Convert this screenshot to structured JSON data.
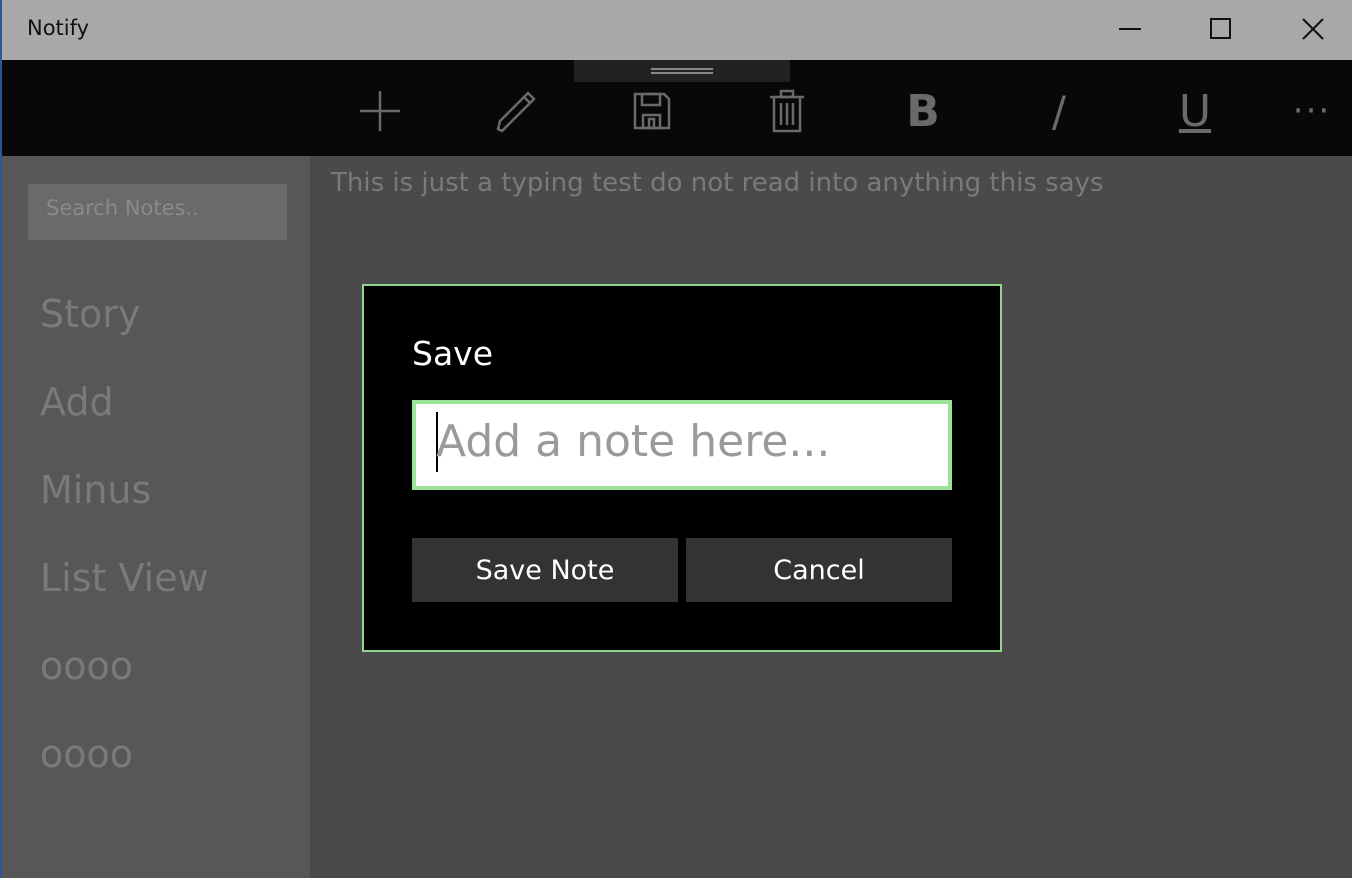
{
  "app": {
    "title": "Notify"
  },
  "window_controls": {
    "minimize_icon": "minimize-icon",
    "maximize_icon": "maximize-icon",
    "close_icon": "close-icon"
  },
  "toolbar": {
    "add_icon": "plus-icon",
    "edit_icon": "pencil-icon",
    "save_icon": "floppy-disk-icon",
    "delete_icon": "trash-icon",
    "bold_label": "B",
    "italic_label": "/",
    "underline_label": "U",
    "more_label": "···"
  },
  "sidebar": {
    "search_placeholder": "Search Notes..",
    "items": [
      {
        "label": "Story"
      },
      {
        "label": "Add"
      },
      {
        "label": "Minus"
      },
      {
        "label": "List View"
      },
      {
        "label": "oooo"
      },
      {
        "label": "oooo"
      }
    ]
  },
  "editor": {
    "text": "This is just a typing test do not read into anything this says"
  },
  "dialog": {
    "title": "Save",
    "input_placeholder": "Add a note here...",
    "save_label": "Save Note",
    "cancel_label": "Cancel",
    "border_color": "#8ed88e"
  }
}
